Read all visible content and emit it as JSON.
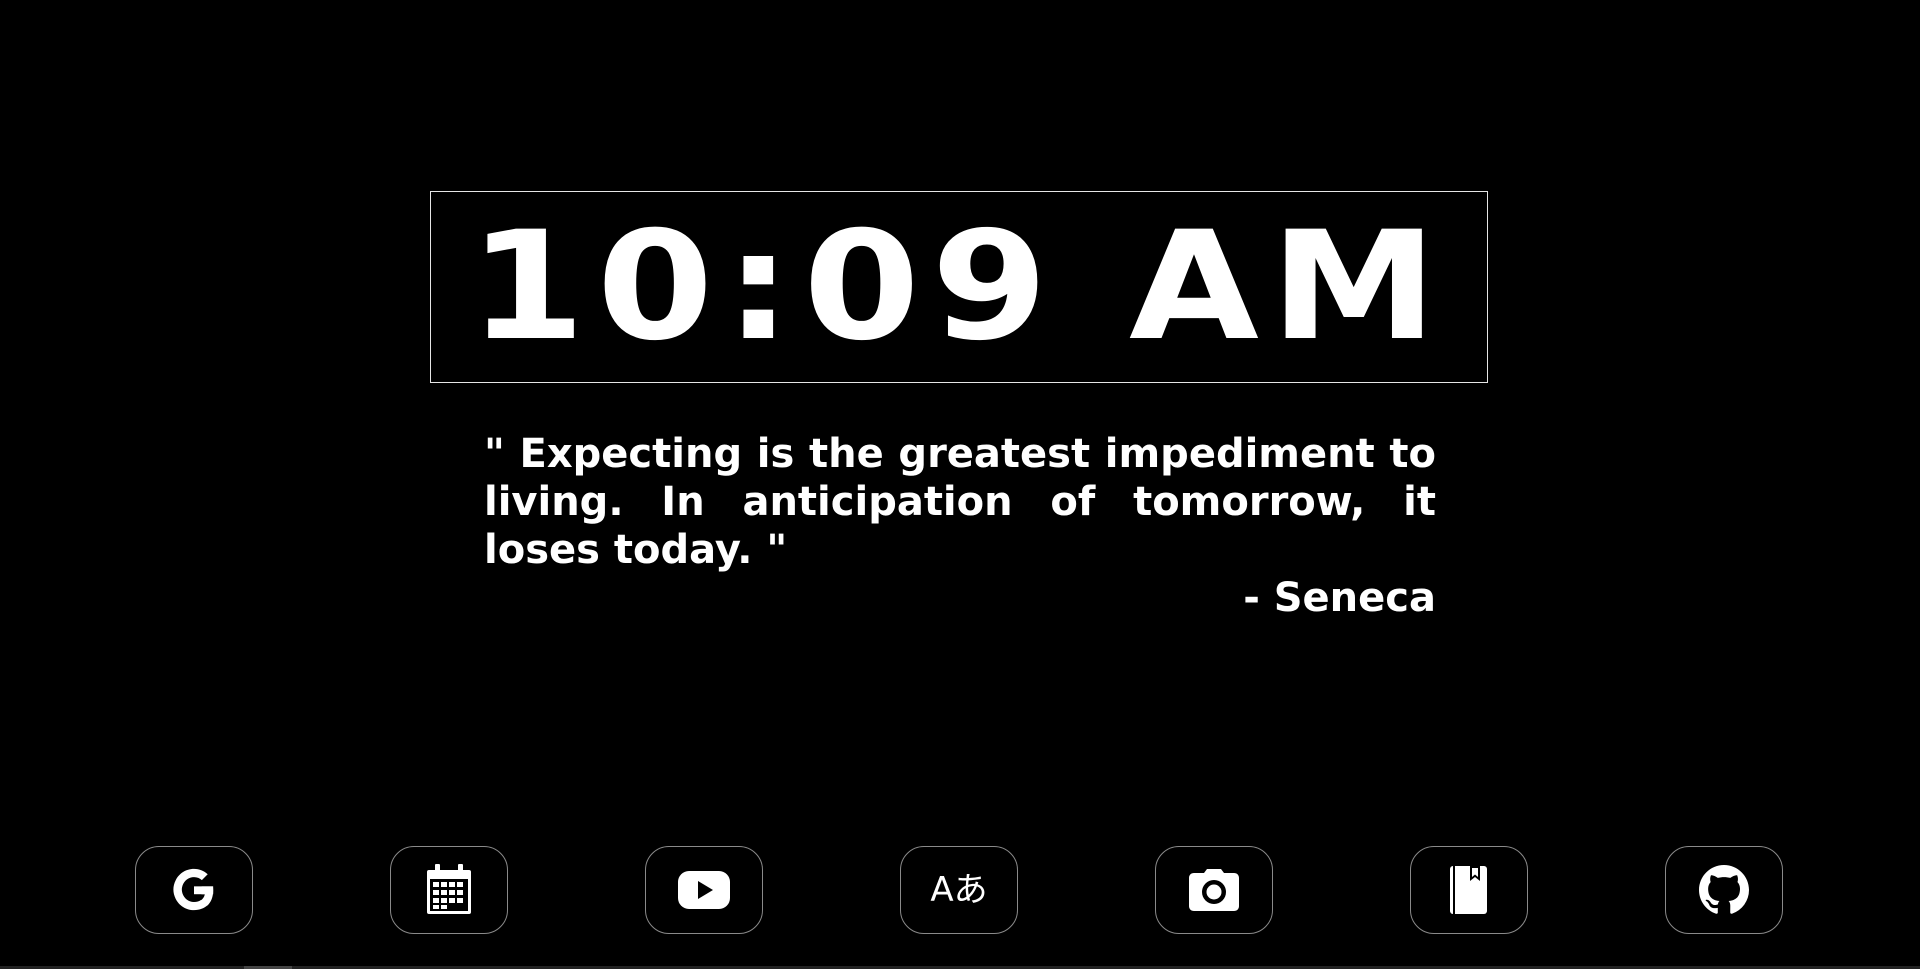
{
  "clock": {
    "time": "10:09 AM"
  },
  "quote": {
    "text": "\" Expecting is the greatest impediment to living. In anticipation of tomorrow, it loses today. \"",
    "author": "- Seneca"
  },
  "dock": {
    "items": [
      {
        "icon": "google-icon"
      },
      {
        "icon": "calendar-icon"
      },
      {
        "icon": "youtube-icon"
      },
      {
        "icon": "translate-icon",
        "glyph": "Aあ"
      },
      {
        "icon": "camera-icon"
      },
      {
        "icon": "bookmark-book-icon"
      },
      {
        "icon": "github-icon"
      }
    ]
  },
  "colors": {
    "background": "#000000",
    "foreground": "#ffffff",
    "border": "#8a8a8a"
  }
}
